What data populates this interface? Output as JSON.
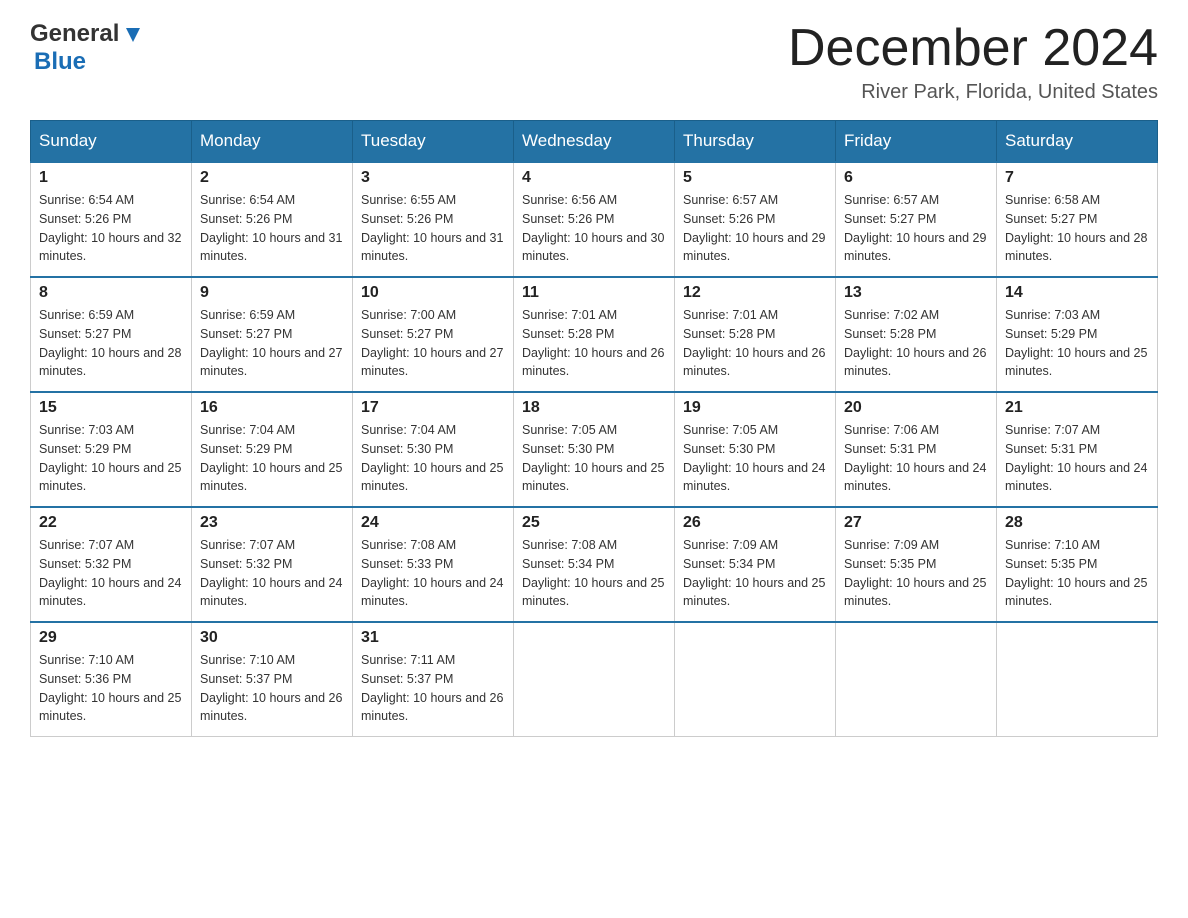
{
  "header": {
    "logo": {
      "text_general": "General",
      "text_blue": "Blue",
      "aria": "GeneralBlue logo"
    },
    "month_title": "December 2024",
    "location": "River Park, Florida, United States"
  },
  "weekdays": [
    "Sunday",
    "Monday",
    "Tuesday",
    "Wednesday",
    "Thursday",
    "Friday",
    "Saturday"
  ],
  "weeks": [
    [
      {
        "day": "1",
        "sunrise": "Sunrise: 6:54 AM",
        "sunset": "Sunset: 5:26 PM",
        "daylight": "Daylight: 10 hours and 32 minutes."
      },
      {
        "day": "2",
        "sunrise": "Sunrise: 6:54 AM",
        "sunset": "Sunset: 5:26 PM",
        "daylight": "Daylight: 10 hours and 31 minutes."
      },
      {
        "day": "3",
        "sunrise": "Sunrise: 6:55 AM",
        "sunset": "Sunset: 5:26 PM",
        "daylight": "Daylight: 10 hours and 31 minutes."
      },
      {
        "day": "4",
        "sunrise": "Sunrise: 6:56 AM",
        "sunset": "Sunset: 5:26 PM",
        "daylight": "Daylight: 10 hours and 30 minutes."
      },
      {
        "day": "5",
        "sunrise": "Sunrise: 6:57 AM",
        "sunset": "Sunset: 5:26 PM",
        "daylight": "Daylight: 10 hours and 29 minutes."
      },
      {
        "day": "6",
        "sunrise": "Sunrise: 6:57 AM",
        "sunset": "Sunset: 5:27 PM",
        "daylight": "Daylight: 10 hours and 29 minutes."
      },
      {
        "day": "7",
        "sunrise": "Sunrise: 6:58 AM",
        "sunset": "Sunset: 5:27 PM",
        "daylight": "Daylight: 10 hours and 28 minutes."
      }
    ],
    [
      {
        "day": "8",
        "sunrise": "Sunrise: 6:59 AM",
        "sunset": "Sunset: 5:27 PM",
        "daylight": "Daylight: 10 hours and 28 minutes."
      },
      {
        "day": "9",
        "sunrise": "Sunrise: 6:59 AM",
        "sunset": "Sunset: 5:27 PM",
        "daylight": "Daylight: 10 hours and 27 minutes."
      },
      {
        "day": "10",
        "sunrise": "Sunrise: 7:00 AM",
        "sunset": "Sunset: 5:27 PM",
        "daylight": "Daylight: 10 hours and 27 minutes."
      },
      {
        "day": "11",
        "sunrise": "Sunrise: 7:01 AM",
        "sunset": "Sunset: 5:28 PM",
        "daylight": "Daylight: 10 hours and 26 minutes."
      },
      {
        "day": "12",
        "sunrise": "Sunrise: 7:01 AM",
        "sunset": "Sunset: 5:28 PM",
        "daylight": "Daylight: 10 hours and 26 minutes."
      },
      {
        "day": "13",
        "sunrise": "Sunrise: 7:02 AM",
        "sunset": "Sunset: 5:28 PM",
        "daylight": "Daylight: 10 hours and 26 minutes."
      },
      {
        "day": "14",
        "sunrise": "Sunrise: 7:03 AM",
        "sunset": "Sunset: 5:29 PM",
        "daylight": "Daylight: 10 hours and 25 minutes."
      }
    ],
    [
      {
        "day": "15",
        "sunrise": "Sunrise: 7:03 AM",
        "sunset": "Sunset: 5:29 PM",
        "daylight": "Daylight: 10 hours and 25 minutes."
      },
      {
        "day": "16",
        "sunrise": "Sunrise: 7:04 AM",
        "sunset": "Sunset: 5:29 PM",
        "daylight": "Daylight: 10 hours and 25 minutes."
      },
      {
        "day": "17",
        "sunrise": "Sunrise: 7:04 AM",
        "sunset": "Sunset: 5:30 PM",
        "daylight": "Daylight: 10 hours and 25 minutes."
      },
      {
        "day": "18",
        "sunrise": "Sunrise: 7:05 AM",
        "sunset": "Sunset: 5:30 PM",
        "daylight": "Daylight: 10 hours and 25 minutes."
      },
      {
        "day": "19",
        "sunrise": "Sunrise: 7:05 AM",
        "sunset": "Sunset: 5:30 PM",
        "daylight": "Daylight: 10 hours and 24 minutes."
      },
      {
        "day": "20",
        "sunrise": "Sunrise: 7:06 AM",
        "sunset": "Sunset: 5:31 PM",
        "daylight": "Daylight: 10 hours and 24 minutes."
      },
      {
        "day": "21",
        "sunrise": "Sunrise: 7:07 AM",
        "sunset": "Sunset: 5:31 PM",
        "daylight": "Daylight: 10 hours and 24 minutes."
      }
    ],
    [
      {
        "day": "22",
        "sunrise": "Sunrise: 7:07 AM",
        "sunset": "Sunset: 5:32 PM",
        "daylight": "Daylight: 10 hours and 24 minutes."
      },
      {
        "day": "23",
        "sunrise": "Sunrise: 7:07 AM",
        "sunset": "Sunset: 5:32 PM",
        "daylight": "Daylight: 10 hours and 24 minutes."
      },
      {
        "day": "24",
        "sunrise": "Sunrise: 7:08 AM",
        "sunset": "Sunset: 5:33 PM",
        "daylight": "Daylight: 10 hours and 24 minutes."
      },
      {
        "day": "25",
        "sunrise": "Sunrise: 7:08 AM",
        "sunset": "Sunset: 5:34 PM",
        "daylight": "Daylight: 10 hours and 25 minutes."
      },
      {
        "day": "26",
        "sunrise": "Sunrise: 7:09 AM",
        "sunset": "Sunset: 5:34 PM",
        "daylight": "Daylight: 10 hours and 25 minutes."
      },
      {
        "day": "27",
        "sunrise": "Sunrise: 7:09 AM",
        "sunset": "Sunset: 5:35 PM",
        "daylight": "Daylight: 10 hours and 25 minutes."
      },
      {
        "day": "28",
        "sunrise": "Sunrise: 7:10 AM",
        "sunset": "Sunset: 5:35 PM",
        "daylight": "Daylight: 10 hours and 25 minutes."
      }
    ],
    [
      {
        "day": "29",
        "sunrise": "Sunrise: 7:10 AM",
        "sunset": "Sunset: 5:36 PM",
        "daylight": "Daylight: 10 hours and 25 minutes."
      },
      {
        "day": "30",
        "sunrise": "Sunrise: 7:10 AM",
        "sunset": "Sunset: 5:37 PM",
        "daylight": "Daylight: 10 hours and 26 minutes."
      },
      {
        "day": "31",
        "sunrise": "Sunrise: 7:11 AM",
        "sunset": "Sunset: 5:37 PM",
        "daylight": "Daylight: 10 hours and 26 minutes."
      },
      null,
      null,
      null,
      null
    ]
  ]
}
